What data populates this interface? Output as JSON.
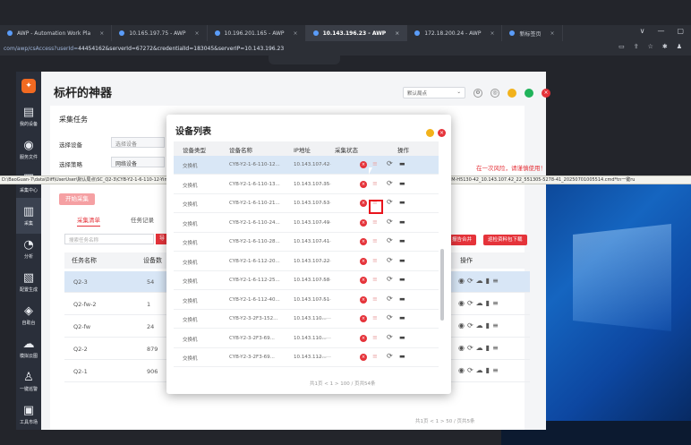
{
  "browser": {
    "tabs": [
      {
        "label": "AWP - Automation Work Pla",
        "active": false
      },
      {
        "label": "10.165.197.75 - AWP",
        "active": false
      },
      {
        "label": "10.196.201.165 - AWP",
        "active": false
      },
      {
        "label": "10.143.196.23 - AWP",
        "active": true
      },
      {
        "label": "172.18.200.24 - AWP",
        "active": false
      },
      {
        "label": "新标签页",
        "active": false
      }
    ],
    "url_prefix": "com/awp/csAccess?userId=",
    "url_rest": "44454162&serverId=67272&credentialId=183045&serverIP=10.143.196.23"
  },
  "nav": {
    "items": [
      {
        "label": "我的设备",
        "icon": "▤"
      },
      {
        "label": "服务文件",
        "icon": "◉"
      },
      {
        "label": "采集中心",
        "icon": "▦"
      },
      {
        "label": "采集",
        "icon": "▥"
      },
      {
        "label": "分析",
        "icon": "◔"
      },
      {
        "label": "配置生成",
        "icon": "▧"
      },
      {
        "label": "自助台",
        "icon": "◈"
      },
      {
        "label": "模拟云图",
        "icon": "☁"
      },
      {
        "label": "一键巡警",
        "icon": "♙"
      },
      {
        "label": "工具市场",
        "icon": "▣"
      }
    ]
  },
  "header": {
    "title": "标杆的神器",
    "default_node": "默认局点"
  },
  "task": {
    "section_title": "采集任务",
    "select_device_label": "选择设备",
    "select_device_value": "选择设备",
    "select_strategy_label": "选择策略",
    "select_strategy_value": "网络设备",
    "warning": "在一次风险，请谨慎使用！",
    "start_btn": "开始采集",
    "tabs": [
      "采集清单",
      "任务记录"
    ],
    "search_placeholder": "搜索任务名称",
    "import_btn": "导",
    "merge_btn": "报告合并",
    "download_btn": "巡检资料包下载",
    "columns": [
      "任务名称",
      "设备数",
      "操作"
    ],
    "rows": [
      {
        "name": "Q2-3",
        "count": "54"
      },
      {
        "name": "Q2-fw-2",
        "count": "1"
      },
      {
        "name": "Q2-fw",
        "count": "24"
      },
      {
        "name": "Q2-2",
        "count": "879"
      },
      {
        "name": "Q2-1",
        "count": "906"
      }
    ],
    "pager": "共1页 < 1 > 50 / 页共5条"
  },
  "path_tooltip": "D:\\BaoGuan-7\\data\\Diff\\UserUser\\默认局点\\SC_Q2-3\\CYB-Y2-1-6-110-12-Yin\\MxQe#30-M-H5130-42\\BrainCollect\\result_20250701\\005186778\\cmds\\result\\network\\ssh_CYB-Y2-1-6-110-12-YinXiMoQe#30-M-H5130-42_10.143.107.42_22_551305-5278-41_20250701005514.cmd*tn一键ru",
  "modal": {
    "title": "设备列表",
    "columns": [
      "设备类型",
      "设备名称",
      "IP地址",
      "采集状态",
      "操作"
    ],
    "rows": [
      {
        "type": "交换机",
        "name": "CYB-Y2-1-6-110-12...",
        "ip": "10.143.107.42",
        "status": "--------"
      },
      {
        "type": "交换机",
        "name": "CYB-Y2-1-6-110-13...",
        "ip": "10.143.107.35",
        "status": "--------"
      },
      {
        "type": "交换机",
        "name": "CYB-Y2-1-6-110-21...",
        "ip": "10.143.107.53",
        "status": "--------"
      },
      {
        "type": "交换机",
        "name": "CYB-Y2-1-6-110-24...",
        "ip": "10.143.107.49",
        "status": "--------"
      },
      {
        "type": "交换机",
        "name": "CYB-Y2-1-6-110-28...",
        "ip": "10.143.107.41",
        "status": "--------"
      },
      {
        "type": "交换机",
        "name": "CYB-Y2-1-6-112-20...",
        "ip": "10.143.107.22",
        "status": "--------"
      },
      {
        "type": "交换机",
        "name": "CYB-Y2-1-6-112-25...",
        "ip": "10.143.107.58",
        "status": "--------"
      },
      {
        "type": "交换机",
        "name": "CYB-Y2-1-6-112-40...",
        "ip": "10.143.107.51",
        "status": "--------"
      },
      {
        "type": "交换机",
        "name": "CYB-Y2-3-2F3-152...",
        "ip": "10.143.110...",
        "status": "--------"
      },
      {
        "type": "交换机",
        "name": "CYB-Y2-3-2F3-69...",
        "ip": "10.143.110...",
        "status": "--------"
      },
      {
        "type": "交换机",
        "name": "CYB-Y2-3-2F3-69...",
        "ip": "10.143.112...",
        "status": "--------"
      }
    ],
    "pager": "共1页 < 1 > 100 / 页共54条"
  }
}
